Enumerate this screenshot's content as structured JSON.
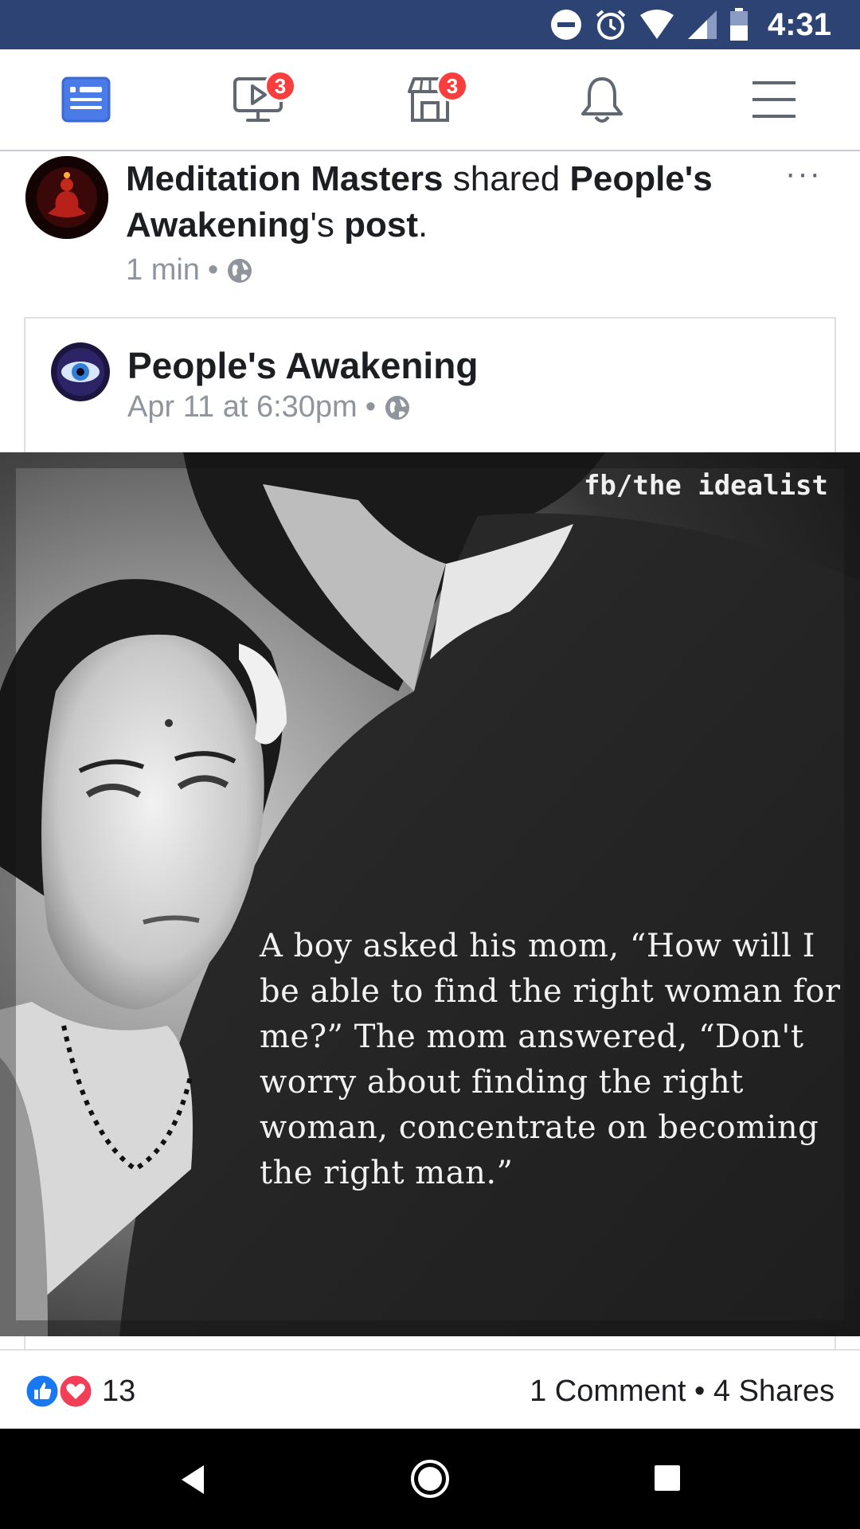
{
  "status_bar": {
    "time": "4:31"
  },
  "nav": {
    "video_badge": "3",
    "marketplace_badge": "3"
  },
  "post": {
    "author": "Meditation Masters",
    "action": " shared ",
    "original_author": "People's Awakening",
    "possessive": "'s ",
    "object": "post",
    "period": ".",
    "time": "1 min",
    "separator": "•",
    "more": "···"
  },
  "shared_post": {
    "author": "People's Awakening",
    "time": "Apr 11 at 6:30pm",
    "separator": "•"
  },
  "image": {
    "watermark": "fb/the idealist",
    "quote": "A boy asked his mom, “How will I be able to find the right woman for me?” The mom answered, “Don't worry about finding the right woman, concentrate on becoming the right man.”"
  },
  "reactions": {
    "count": "13",
    "engagement": "1 Comment • 4 Shares"
  },
  "colors": {
    "status_bar": "#2d4373",
    "accent": "#4267b2",
    "badge": "#fa3e3e",
    "like": "#1877f2",
    "love": "#f33e58"
  }
}
